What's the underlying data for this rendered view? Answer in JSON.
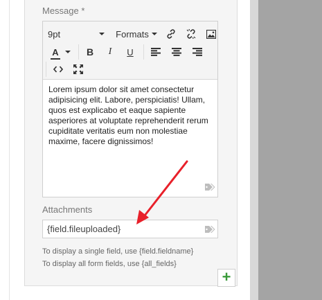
{
  "form": {
    "message_label": "Message *",
    "attachments_label": "Attachments",
    "attachments_value": "{field.fileuploaded}",
    "help_single": "To display a single field, use {field.fieldname}",
    "help_all": "To display all form fields, use {all_fields}"
  },
  "editor": {
    "font_size": "9pt",
    "formats_label": "Formats",
    "content": "Lorem ipsum dolor sit amet consectetur adipisicing elit. Labore, perspiciatis! Ullam, quos est explicabo et eaque sapiente asperiores at voluptate reprehenderit rerum cupiditate veritatis eum non molestiae maxime, facere dignissimos!",
    "icons": [
      "chevron-down-icon",
      "link-icon",
      "unlink-icon",
      "image-icon",
      "text-color-icon",
      "bold-icon",
      "italic-icon",
      "underline-icon",
      "align-left-icon",
      "align-center-icon",
      "align-right-icon",
      "code-icon",
      "fullscreen-icon",
      "tag-icon"
    ]
  },
  "add_button": {
    "label": "+"
  },
  "colors": {
    "arrow": "#e8202a",
    "panel": "#f5f5f5",
    "add_icon": "#3a9a3a"
  }
}
